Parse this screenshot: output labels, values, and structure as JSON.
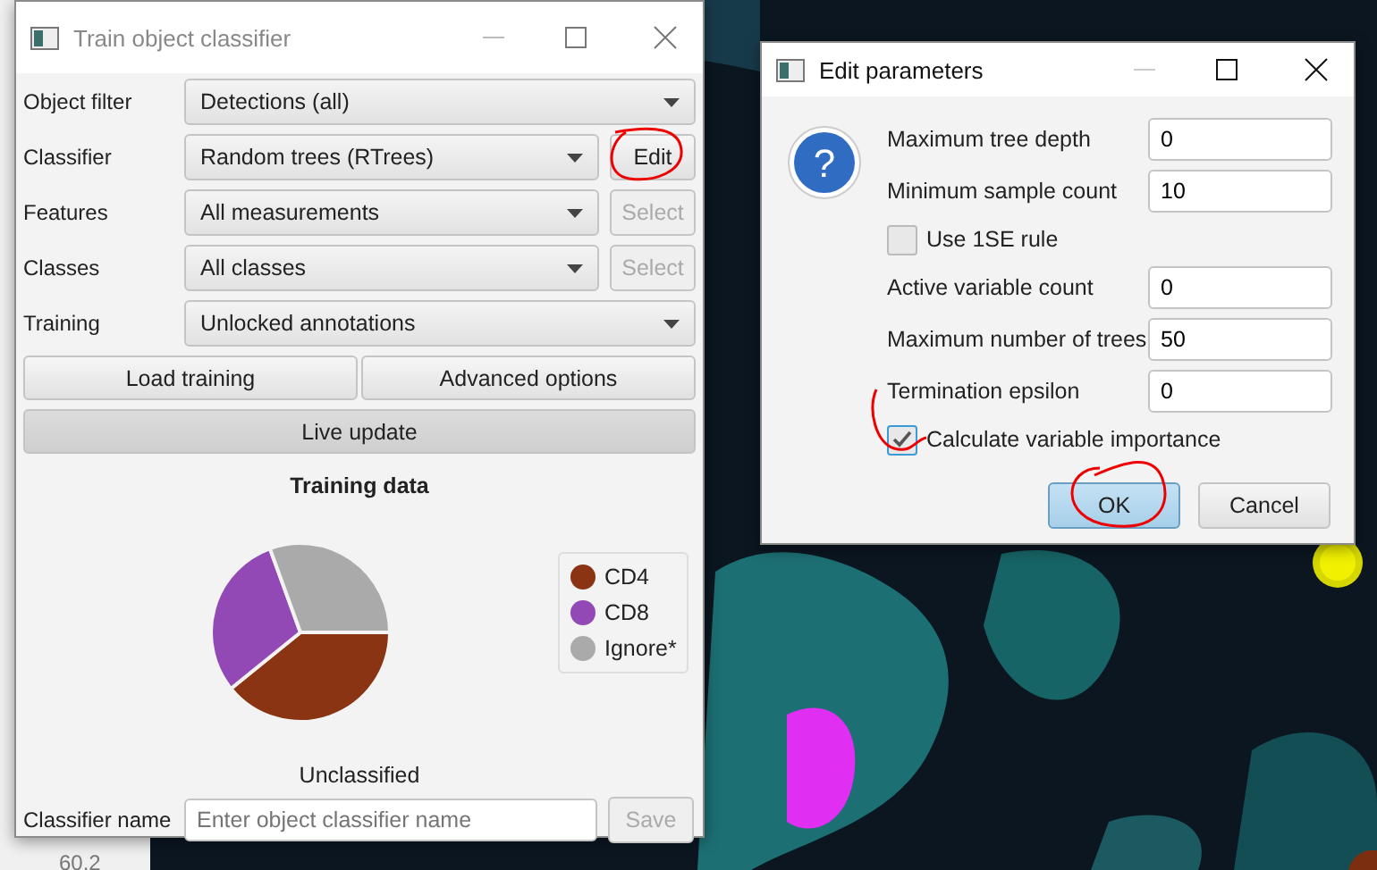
{
  "side_panel": {
    "reading": "60.2"
  },
  "classifier_window": {
    "title": "Train object classifier",
    "rows": [
      {
        "label": "Object filter",
        "value": "Detections (all)"
      },
      {
        "label": "Classifier",
        "value": "Random trees (RTrees)",
        "button": {
          "label": "Edit",
          "disabled": false
        }
      },
      {
        "label": "Features",
        "value": "All measurements",
        "button": {
          "label": "Select",
          "disabled": true
        }
      },
      {
        "label": "Classes",
        "value": "All classes",
        "button": {
          "label": "Select",
          "disabled": true
        }
      },
      {
        "label": "Training",
        "value": "Unlocked annotations"
      }
    ],
    "buttons": [
      {
        "label": "Load training"
      },
      {
        "label": "Advanced options"
      }
    ],
    "live_update": {
      "label": "Live update",
      "selected": true
    },
    "training_data": {
      "title": "Training data",
      "legend": [
        {
          "label": "CD4",
          "color": "#8a3413"
        },
        {
          "label": "CD8",
          "color": "#9248b5"
        },
        {
          "label": "Ignore*",
          "color": "#aaaaaa"
        }
      ],
      "caption": "Unclassified"
    },
    "name_field": {
      "label": "Classifier name",
      "placeholder": "Enter object classifier name"
    },
    "save_button": {
      "label": "Save",
      "disabled": true
    }
  },
  "dialog": {
    "title": "Edit parameters",
    "icon": "?",
    "items": [
      {
        "kind": "field",
        "label": "Maximum tree depth",
        "value": "0"
      },
      {
        "kind": "field",
        "label": "Minimum sample count",
        "value": "10"
      },
      {
        "kind": "checkbox",
        "label": "Use 1SE rule",
        "checked": false
      },
      {
        "kind": "field",
        "label": "Active variable count",
        "value": "0"
      },
      {
        "kind": "field",
        "label": "Maximum number of trees",
        "value": "50"
      },
      {
        "kind": "field",
        "label": "Termination epsilon",
        "value": "0"
      },
      {
        "kind": "checkbox",
        "label": "Calculate variable importance",
        "checked": true
      }
    ],
    "buttons": [
      {
        "label": "OK",
        "default": true
      },
      {
        "label": "Cancel",
        "default": false
      }
    ]
  }
}
